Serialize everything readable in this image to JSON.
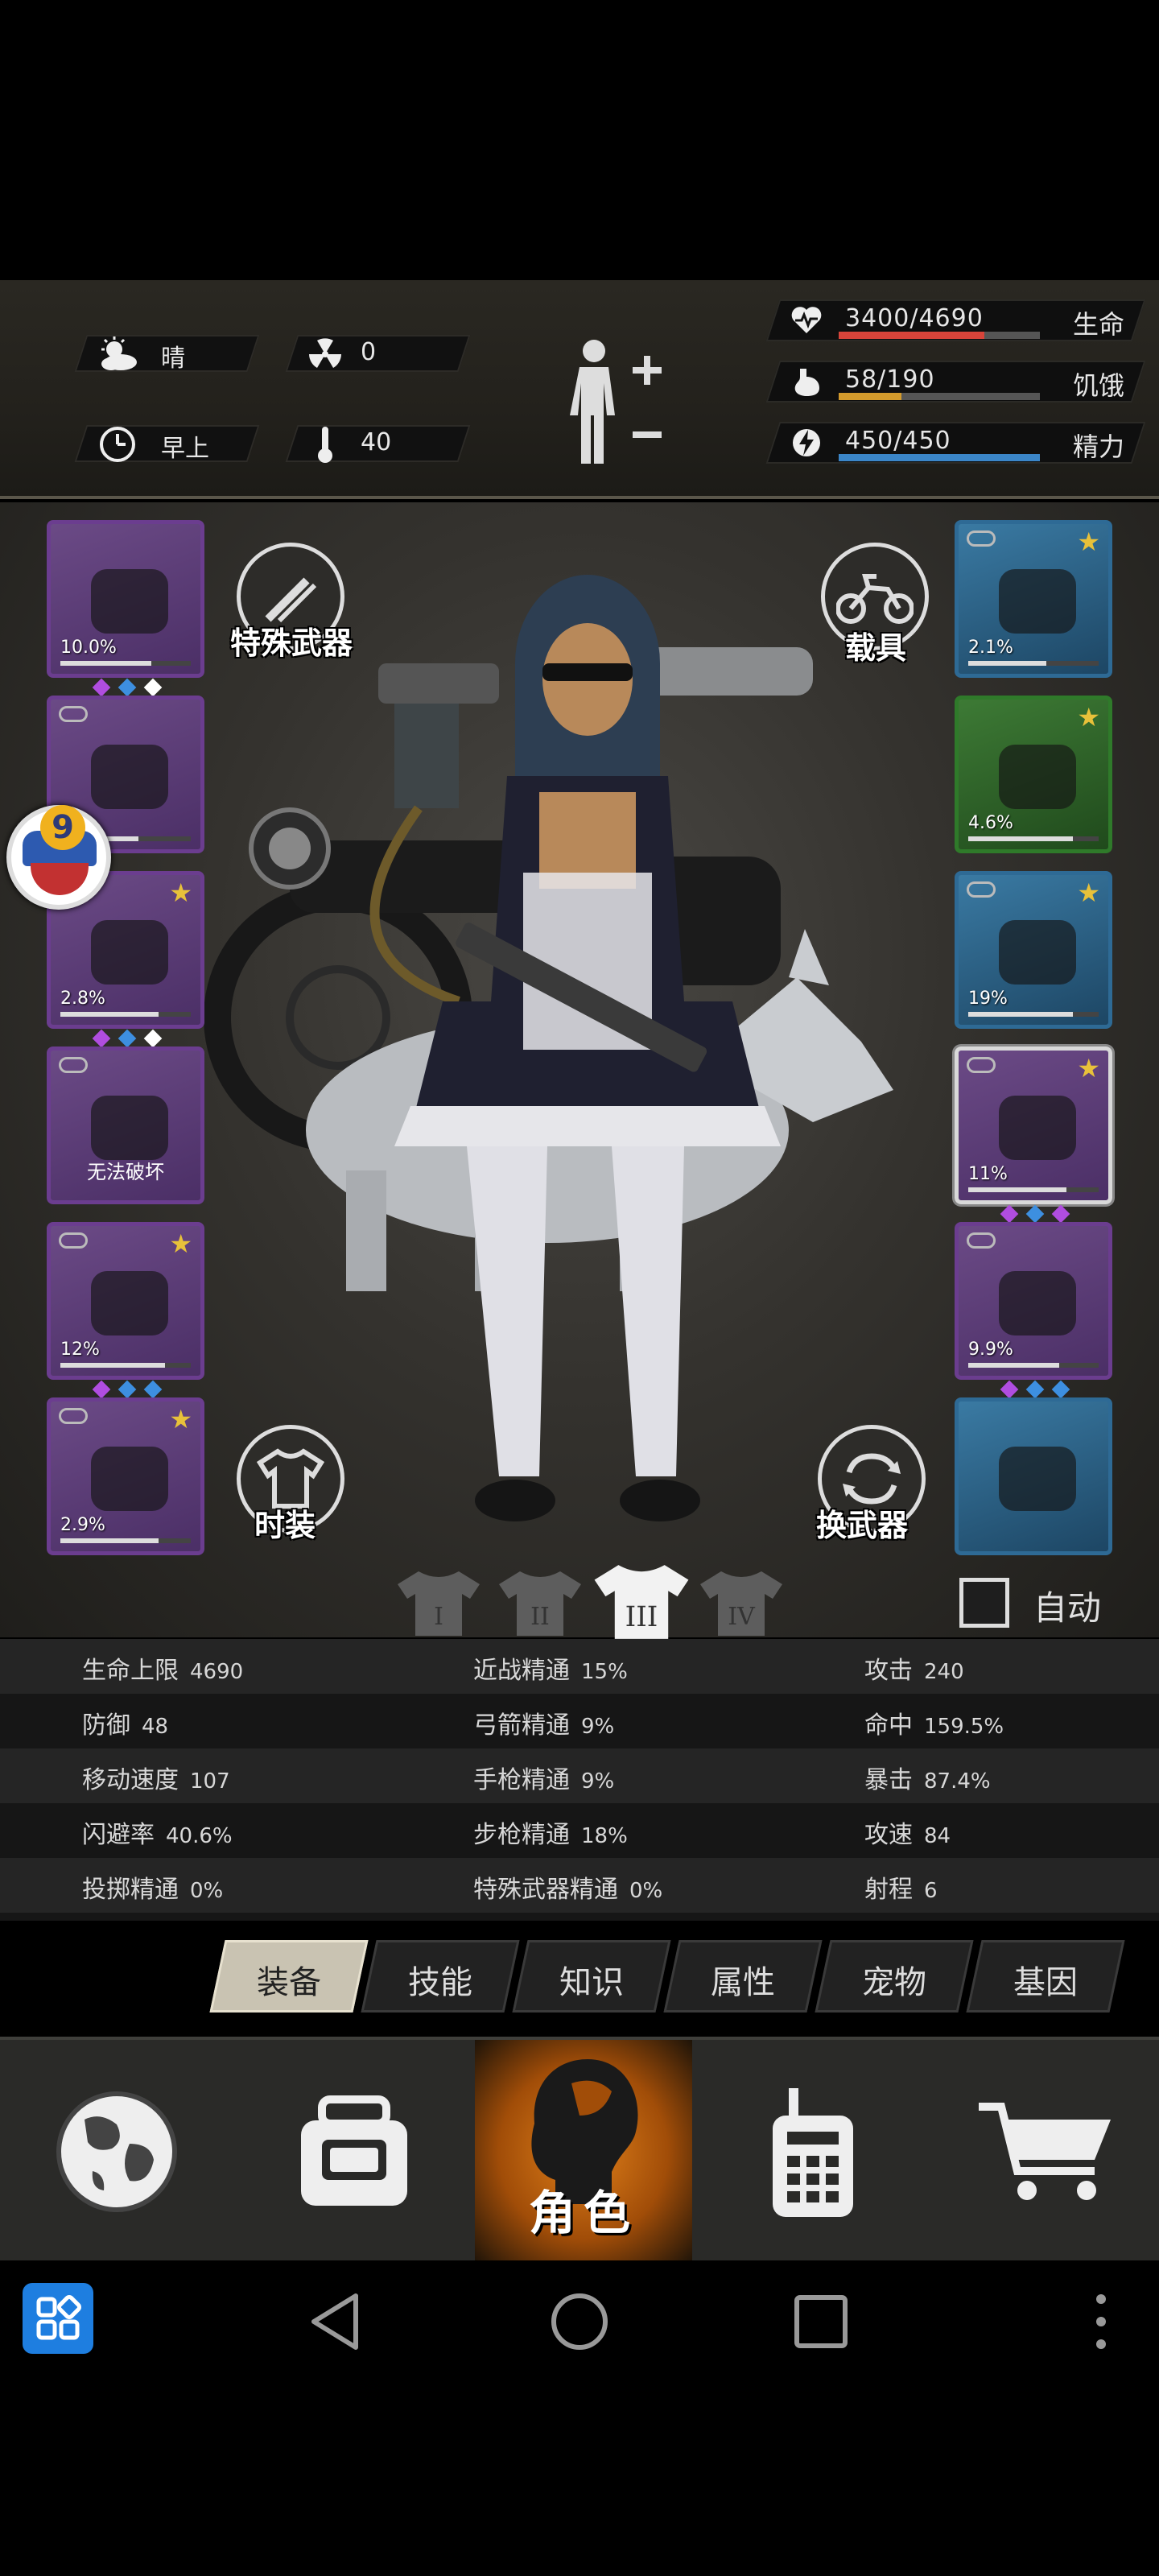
{
  "status": {
    "weather": "晴",
    "radiation": "0",
    "time_of_day": "早上",
    "temperature": "40"
  },
  "bars": [
    {
      "value": "3400/4690",
      "label": "生命",
      "fill": 0.725,
      "color": "#d8443a",
      "icon": "heart-pulse-icon"
    },
    {
      "value": "58/190",
      "label": "饥饿",
      "fill": 0.31,
      "color": "#d39a2c",
      "icon": "stomach-icon"
    },
    {
      "value": "450/450",
      "label": "精力",
      "fill": 1.0,
      "color": "#3b86c8",
      "icon": "lightning-icon"
    }
  ],
  "left_slots": [
    {
      "name": "helmet-slot",
      "pct": "10.0%",
      "durability": 0.7,
      "star": false,
      "link": false,
      "gems": [
        "#b04de0",
        "#3d8fe0",
        "#ffffff"
      ]
    },
    {
      "name": "shirt-slot",
      "pct": "",
      "durability": 0.6,
      "star": false,
      "link": true,
      "gems": []
    },
    {
      "name": "jacket-slot",
      "pct": "2.8%",
      "durability": 0.75,
      "star": true,
      "link": false,
      "gems": [
        "#b04de0",
        "#3d8fe0",
        "#ffffff"
      ]
    },
    {
      "name": "backpack-slot",
      "pct": "",
      "note": "无法破坏",
      "durability": 0,
      "star": false,
      "link": true,
      "gems": []
    },
    {
      "name": "pants-slot",
      "pct": "12%",
      "durability": 0.8,
      "star": true,
      "link": true,
      "gems": [
        "#b04de0",
        "#3d8fe0",
        "#3d8fe0"
      ]
    },
    {
      "name": "boots-slot",
      "pct": "2.9%",
      "durability": 0.75,
      "star": true,
      "link": true,
      "gems": []
    }
  ],
  "right_slots": [
    {
      "name": "glasses-slot",
      "tier": "blue",
      "pct": "2.1%",
      "durability": 0.6,
      "star": true,
      "link": true,
      "gems": []
    },
    {
      "name": "mask-slot",
      "tier": "green",
      "pct": "4.6%",
      "durability": 0.8,
      "star": true,
      "link": false,
      "gems": []
    },
    {
      "name": "vest-slot",
      "tier": "blue",
      "pct": "19%",
      "durability": 0.8,
      "star": true,
      "link": true,
      "gems": []
    },
    {
      "name": "rifle-slot",
      "tier": "purple",
      "pct": "11%",
      "durability": 0.75,
      "star": true,
      "link": true,
      "selected": true,
      "gems": [
        "#b04de0",
        "#3d8fe0",
        "#b04de0"
      ]
    },
    {
      "name": "blade-slot",
      "tier": "purple",
      "pct": "9.9%",
      "durability": 0.7,
      "star": false,
      "link": true,
      "gems": [
        "#b04de0",
        "#3d8fe0",
        "#3d8fe0"
      ]
    },
    {
      "name": "bag-slot",
      "tier": "blue",
      "pct": "",
      "durability": 0,
      "star": false,
      "link": false,
      "gems": []
    }
  ],
  "buttons": {
    "special_weapon": "特殊武器",
    "vehicle": "载具",
    "fashion": "时装",
    "swap_weapon": "换武器",
    "auto": "自动"
  },
  "badge": {
    "level": "9"
  },
  "outfit_tabs": [
    "I",
    "II",
    "III",
    "IV"
  ],
  "stats": [
    [
      {
        "label": "生命上限",
        "value": "4690"
      },
      {
        "label": "近战精通",
        "value": "15%"
      },
      {
        "label": "攻击",
        "value": "240"
      }
    ],
    [
      {
        "label": "防御",
        "value": "48"
      },
      {
        "label": "弓箭精通",
        "value": "9%"
      },
      {
        "label": "命中",
        "value": "159.5%"
      }
    ],
    [
      {
        "label": "移动速度",
        "value": "107"
      },
      {
        "label": "手枪精通",
        "value": "9%"
      },
      {
        "label": "暴击",
        "value": "87.4%"
      }
    ],
    [
      {
        "label": "闪避率",
        "value": "40.6%"
      },
      {
        "label": "步枪精通",
        "value": "18%"
      },
      {
        "label": "攻速",
        "value": "84"
      }
    ],
    [
      {
        "label": "投掷精通",
        "value": "0%"
      },
      {
        "label": "特殊武器精通",
        "value": "0%"
      },
      {
        "label": "射程",
        "value": "6"
      }
    ]
  ],
  "category_tabs": [
    "装备",
    "技能",
    "知识",
    "属性",
    "宠物",
    "基因"
  ],
  "bottom_nav": {
    "active_label": "角色"
  }
}
